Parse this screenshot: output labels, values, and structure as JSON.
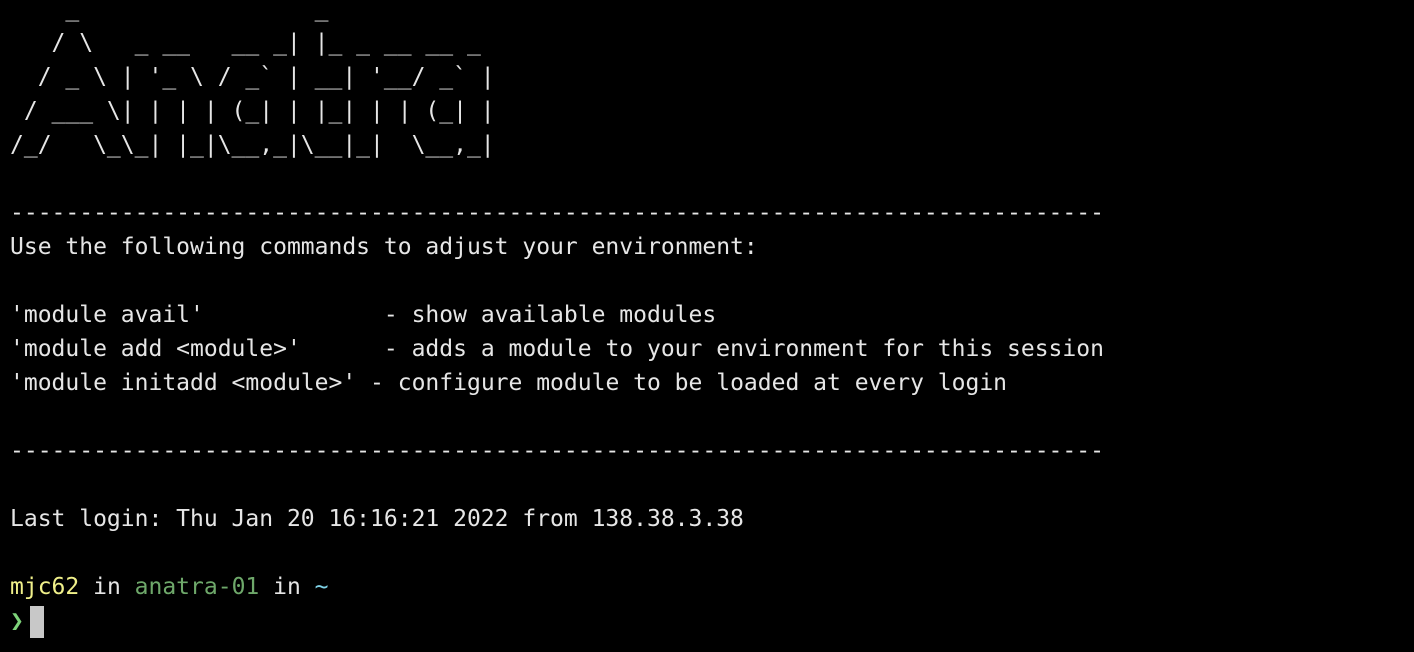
{
  "banner": [
    "    _                 _",
    "   / \\   _ __   __ _| |_ _ __ __ _",
    "  / _ \\ | '_ \\ / _` | __| '__/ _` |",
    " / ___ \\| | | | (_| | |_| | | (_| |",
    "/_/   \\_\\_| |_|\\__,_|\\__|_|  \\__,_|"
  ],
  "motd": {
    "separator": "-------------------------------------------------------------------------------",
    "intro": "Use the following commands to adjust your environment:",
    "commands": [
      {
        "cmd": "'module avail'",
        "desc": "- show available modules"
      },
      {
        "cmd": "'module add <module>'",
        "desc": "- adds a module to your environment for this session"
      },
      {
        "cmd": "'module initadd <module>'",
        "desc": "- configure module to be loaded at every login"
      }
    ]
  },
  "last_login": "Last login: Thu Jan 20 16:16:21 2022 from 138.38.3.38",
  "prompt": {
    "user": "mjc62",
    "in1": " in ",
    "host": "anatra-01",
    "in2": " in ",
    "dir": "~",
    "symbol": "❯"
  },
  "colors": {
    "background": "#000000",
    "text": "#e6e6e6",
    "user": "#f0f08a",
    "host": "#6ea86a",
    "dir": "#7fd3e8",
    "prompt_symbol": "#7ed37a"
  }
}
